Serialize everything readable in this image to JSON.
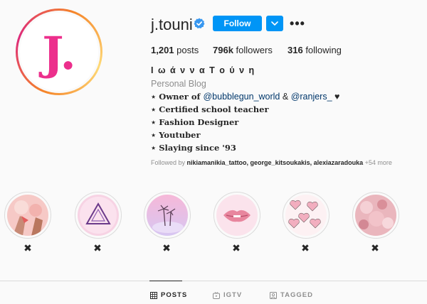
{
  "profile": {
    "username": "j.touni",
    "avatar_letter": "J.",
    "follow_label": "Follow",
    "more_glyph": "•••"
  },
  "stats": {
    "posts_count": "1,201",
    "posts_label": " posts",
    "followers_count": "796k",
    "followers_label": " followers",
    "following_count": "316",
    "following_label": " following"
  },
  "bio": {
    "full_name": "Ι ω ά ν ν α Τ ο ύ ν η",
    "category": "Personal Blog",
    "line1_prefix": "⋆ Owner of ",
    "line1_mention1": "@bubblegun_world",
    "line1_amp": " & ",
    "line1_mention2": "@ranjers_",
    "line1_suffix": " ♥",
    "line2": "⋆ Certified school teacher",
    "line3": "⋆ Fashion Designer",
    "line4": "⋆ Youtuber",
    "line5": "⋆ Slaying since '93"
  },
  "followed_by": {
    "prefix": "Followed by ",
    "names": "nikiamanikia_tattoo, george_kitsoukakis, alexiazaradouka",
    "suffix": " +54 more"
  },
  "highlights": {
    "close_glyph": "✖"
  },
  "tabs": {
    "posts": "POSTS",
    "igtv": "IGTV",
    "tagged": "TAGGED"
  },
  "colors": {
    "accent": "#0095f6",
    "avatar_letter": "#ec2f8c",
    "verified": "#3897f0"
  }
}
